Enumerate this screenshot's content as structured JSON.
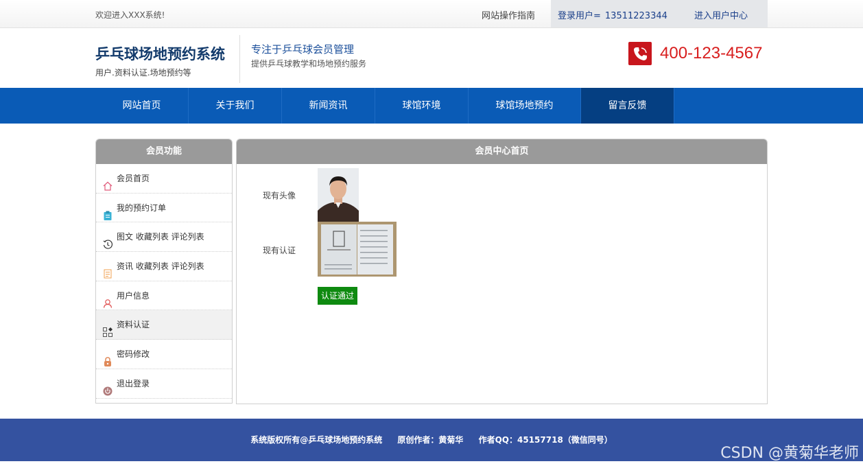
{
  "topbar": {
    "welcome": "欢迎进入XXX系统!",
    "guide": "网站操作指南",
    "login_label": "登录用户=",
    "login_user": "13511223344",
    "user_center": "进入用户中心"
  },
  "header": {
    "title": "乒乓球场地预约系统",
    "subtitle": "用户.资料认证.场地预约等",
    "slogan_main": "专注于乒乓球会员管理",
    "slogan_sub": "提供乒乓球教学和场地预约服务",
    "phone": "400-123-4567"
  },
  "nav": {
    "items": [
      "网站首页",
      "关于我们",
      "新闻资讯",
      "球馆环境",
      "球馆场地预约",
      "留言反馈"
    ],
    "active_index": 5
  },
  "sidebar": {
    "title": "会员功能",
    "items": [
      {
        "label": "会员首页",
        "icon": "home-icon"
      },
      {
        "label": "我的预约订单",
        "icon": "clipboard-icon"
      },
      {
        "label": "图文 收藏列表 评论列表",
        "icon": "history-icon"
      },
      {
        "label": "资讯 收藏列表 评论列表",
        "icon": "document-icon"
      },
      {
        "label": "用户信息",
        "icon": "user-icon"
      },
      {
        "label": "资料认证",
        "icon": "grid-icon"
      },
      {
        "label": "密码修改",
        "icon": "lock-icon"
      },
      {
        "label": "退出登录",
        "icon": "power-icon"
      }
    ],
    "active_index": 5
  },
  "content": {
    "title": "会员中心首页",
    "avatar_label": "现有头像",
    "cert_label": "现有认证",
    "status": "认证通过"
  },
  "footer": {
    "copyright": "系统版权所有@乒乓球场地预约系统",
    "author": "原创作者：黄菊华",
    "qq": "作者QQ：45157718（微信同号）"
  },
  "watermark": "CSDN @黄菊华老师",
  "colors": {
    "nav_bg": "#0a5bb6",
    "nav_active": "#053f82",
    "footer_bg": "#3452a0",
    "phone_red": "#d81e1e",
    "status_green": "#0e8a10"
  }
}
